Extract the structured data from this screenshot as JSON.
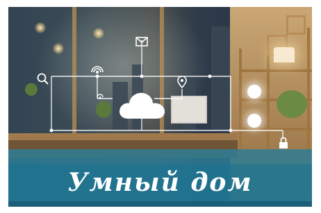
{
  "banner": {
    "caption": "Умный дом",
    "icons": [
      "mail-icon",
      "wifi-icon",
      "search-icon",
      "location-pin-icon",
      "cloud-icon",
      "lock-icon",
      "wifi-small-icon"
    ],
    "colors": {
      "caption_band": "#2076a0",
      "overlay_lines": "#ffffff",
      "shelf_wood": "#b78b55"
    }
  }
}
